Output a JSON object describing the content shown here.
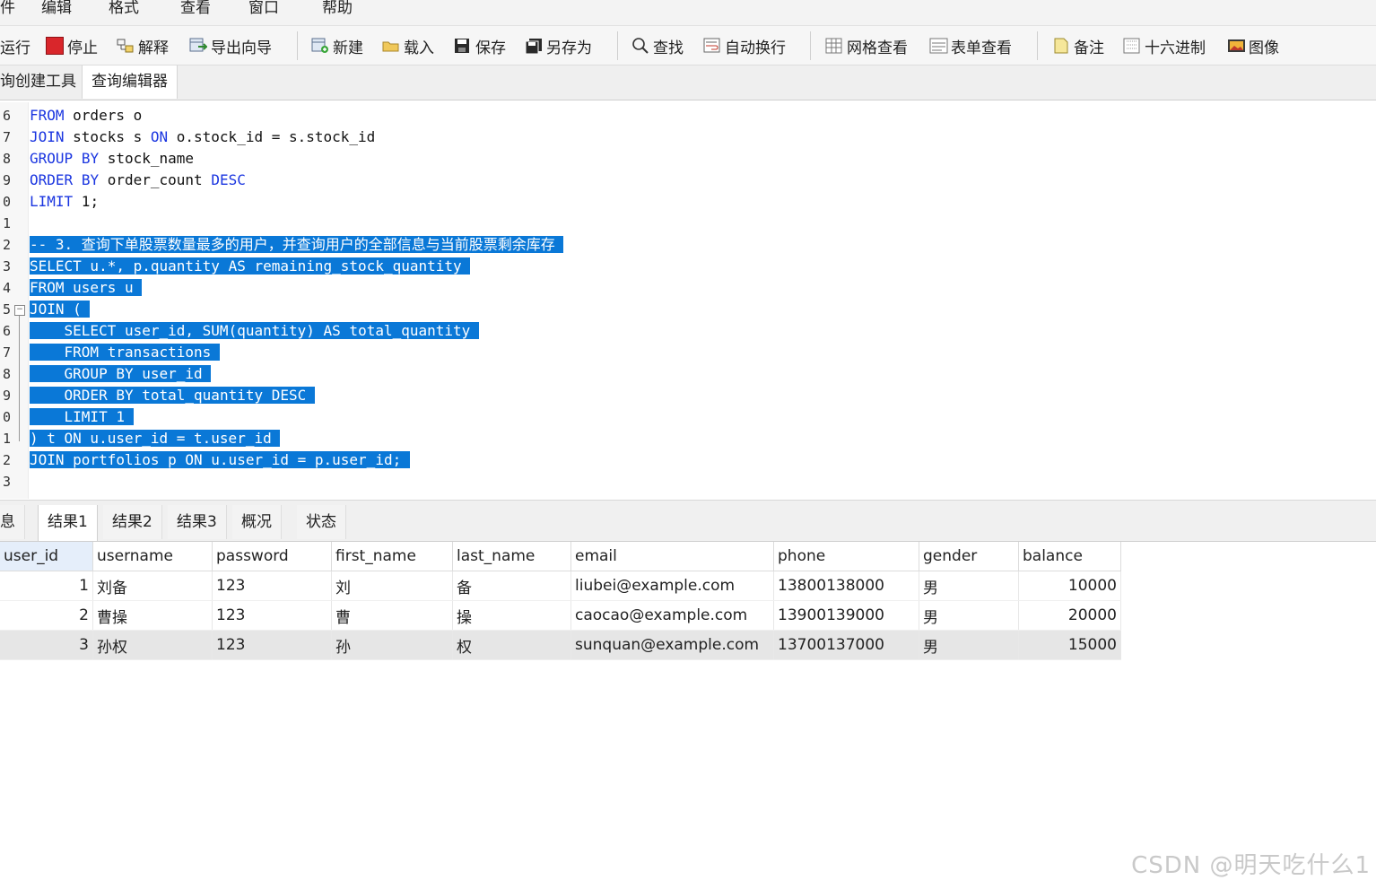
{
  "menu": [
    "件",
    "编辑",
    "格式",
    "查看",
    "窗口",
    "帮助"
  ],
  "toolbar": {
    "run": "运行",
    "stop": "停止",
    "explain": "解释",
    "export_wizard": "导出向导",
    "new": "新建",
    "load": "载入",
    "save": "保存",
    "save_as": "另存为",
    "find": "查找",
    "word_wrap": "自动换行",
    "grid_view": "网格查看",
    "form_view": "表单查看",
    "memo": "备注",
    "hex": "十六进制",
    "image": "图像",
    "colors": {
      "stop": "#d9262b",
      "save": "#2a2a2a",
      "accent": "#0a78d7"
    }
  },
  "editor_tabs": [
    "询创建工具",
    "查询编辑器"
  ],
  "editor": {
    "lines": [
      {
        "no": "6",
        "text": "FROM orders o"
      },
      {
        "no": "7",
        "text": "JOIN stocks s ON o.stock_id = s.stock_id"
      },
      {
        "no": "8",
        "text": "GROUP BY stock_name"
      },
      {
        "no": "9",
        "text": "ORDER BY order_count DESC"
      },
      {
        "no": "0",
        "text": "LIMIT 1;"
      },
      {
        "no": "1",
        "text": ""
      },
      {
        "no": "2",
        "text": "-- 3. 查询下单股票数量最多的用户，并查询用户的全部信息与当前股票剩余库存"
      },
      {
        "no": "3",
        "text": "SELECT u.*, p.quantity AS remaining_stock_quantity"
      },
      {
        "no": "4",
        "text": "FROM users u"
      },
      {
        "no": "5",
        "text": "JOIN ("
      },
      {
        "no": "6",
        "text": "    SELECT user_id, SUM(quantity) AS total_quantity"
      },
      {
        "no": "7",
        "text": "    FROM transactions"
      },
      {
        "no": "8",
        "text": "    GROUP BY user_id"
      },
      {
        "no": "9",
        "text": "    ORDER BY total_quantity DESC"
      },
      {
        "no": "0",
        "text": "    LIMIT 1"
      },
      {
        "no": "1",
        "text": ") t ON u.user_id = t.user_id"
      },
      {
        "no": "2",
        "text": "JOIN portfolios p ON u.user_id = p.user_id;"
      },
      {
        "no": "3",
        "text": ""
      }
    ],
    "fold_marker": "−"
  },
  "result_tabs": [
    "息",
    "结果1",
    "结果2",
    "结果3",
    "概况",
    "状态"
  ],
  "grid": {
    "columns": [
      "user_id",
      "username",
      "password",
      "first_name",
      "last_name",
      "email",
      "phone",
      "gender",
      "balance"
    ],
    "rows": [
      [
        "1",
        "刘备",
        "123",
        "刘",
        "备",
        "liubei@example.com",
        "13800138000",
        "男",
        "10000"
      ],
      [
        "2",
        "曹操",
        "123",
        "曹",
        "操",
        "caocao@example.com",
        "13900139000",
        "男",
        "20000"
      ],
      [
        "3",
        "孙权",
        "123",
        "孙",
        "权",
        "sunquan@example.com",
        "13700137000",
        "男",
        "15000"
      ]
    ]
  },
  "watermark": "CSDN @明天吃什么1"
}
